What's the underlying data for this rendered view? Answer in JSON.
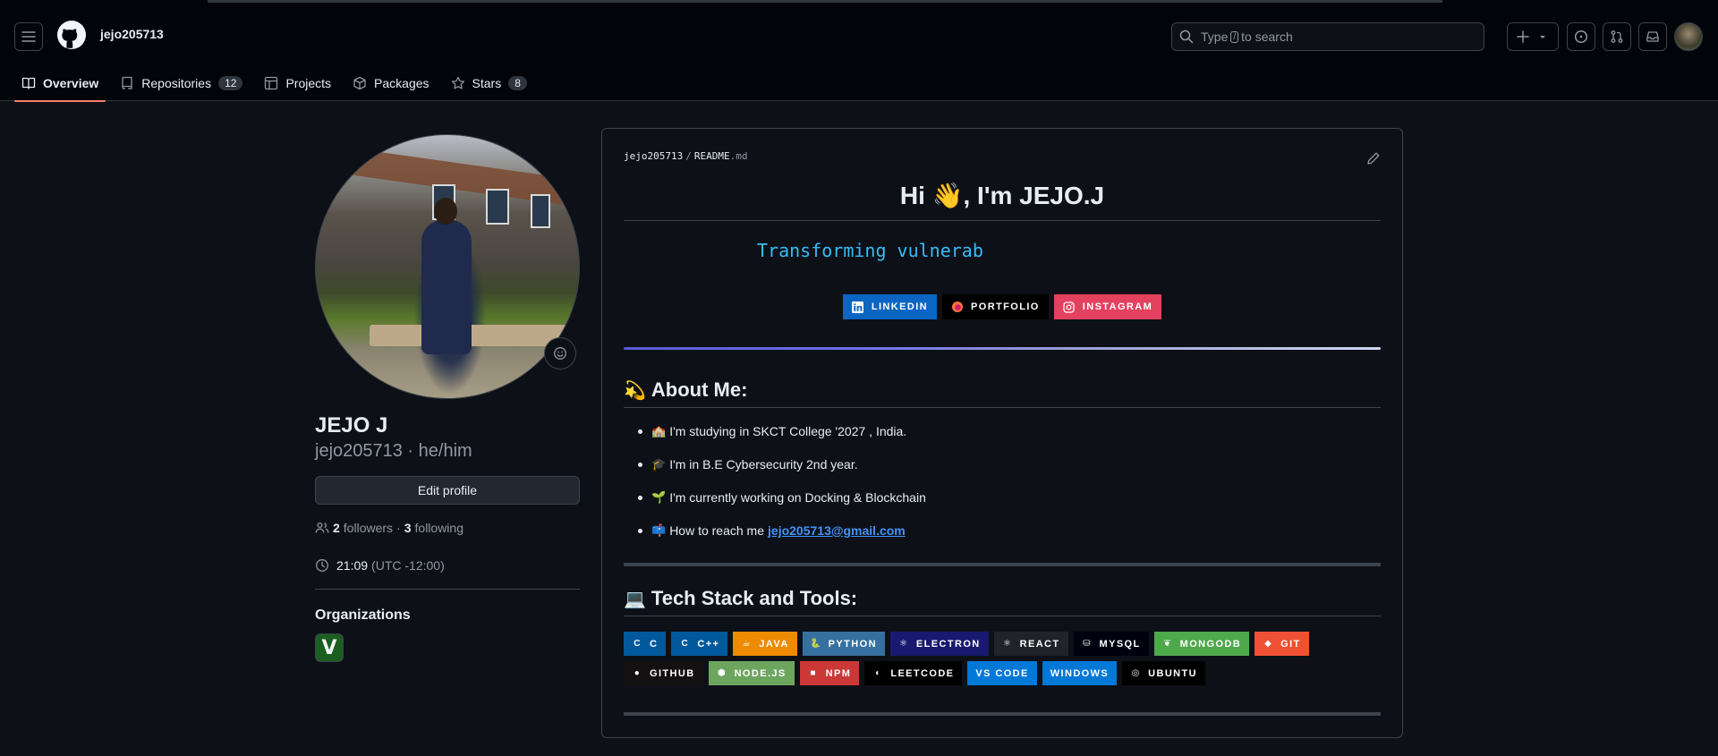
{
  "header": {
    "username": "jejo205713",
    "search_prefix": "Type",
    "search_key": "/",
    "search_suffix": "to search"
  },
  "tabs": [
    {
      "label": "Overview",
      "count": null
    },
    {
      "label": "Repositories",
      "count": "12"
    },
    {
      "label": "Projects",
      "count": null
    },
    {
      "label": "Packages",
      "count": null
    },
    {
      "label": "Stars",
      "count": "8"
    }
  ],
  "profile": {
    "full_name": "JEJO J",
    "handle": "jejo205713 · he/him",
    "edit_label": "Edit profile",
    "followers_count": "2",
    "followers_label": "followers",
    "dot": "·",
    "following_count": "3",
    "following_label": "following",
    "time": "21:09",
    "timezone": "(UTC -12:00)",
    "orgs_heading": "Organizations",
    "org_letter": "V"
  },
  "readme": {
    "owner": "jejo205713",
    "slash": "/",
    "file": "README",
    "ext": ".md",
    "title": "Hi 👋, I'm JEJO.J",
    "typing": "Transforming vulnerab",
    "socials": [
      {
        "label": "LINKEDIN",
        "color": "#0a66c2"
      },
      {
        "label": "PORTFOLIO",
        "color": "#000000"
      },
      {
        "label": "INSTAGRAM",
        "color": "#e4405f"
      }
    ],
    "about_emoji": "💫",
    "about_heading": "About Me:",
    "about_items": [
      {
        "emoji": "🏫",
        "text": "I'm studying in SKCT College '2027 , India.",
        "link": ""
      },
      {
        "emoji": "🎓",
        "text": "I'm in B.E Cybersecurity 2nd year.",
        "link": ""
      },
      {
        "emoji": "🌱",
        "text": "I'm currently working on Docking & Blockchain",
        "link": ""
      },
      {
        "emoji": "📫",
        "text": "How to reach me",
        "link": "jejo205713@gmail.com"
      }
    ],
    "tech_emoji": "💻",
    "tech_heading": "Tech Stack and Tools:",
    "tech": [
      {
        "label": "C",
        "color": "#00599c",
        "icon": "C"
      },
      {
        "label": "C++",
        "color": "#00599c",
        "icon": "C"
      },
      {
        "label": "JAVA",
        "color": "#ed8b00",
        "icon": "☕"
      },
      {
        "label": "PYTHON",
        "color": "#3670a0",
        "icon": "🐍"
      },
      {
        "label": "ELECTRON",
        "color": "#191970",
        "icon": "⚛"
      },
      {
        "label": "REACT",
        "color": "#20232a",
        "icon": "⚛"
      },
      {
        "label": "MYSQL",
        "color": "#00000f",
        "icon": "⛁"
      },
      {
        "label": "MONGODB",
        "color": "#4ea94b",
        "icon": "❦"
      },
      {
        "label": "GIT",
        "color": "#f05033",
        "icon": "◆"
      },
      {
        "label": "GITHUB",
        "color": "#121011",
        "icon": "●"
      },
      {
        "label": "NODE.JS",
        "color": "#6da55f",
        "icon": "⬢"
      },
      {
        "label": "NPM",
        "color": "#cb3837",
        "icon": "■"
      },
      {
        "label": "LEETCODE",
        "color": "#000000",
        "icon": "◐"
      },
      {
        "label": "VS CODE",
        "color": "#0078d7",
        "icon": ""
      },
      {
        "label": "WINDOWS",
        "color": "#0078d6",
        "icon": ""
      },
      {
        "label": "UBUNTU",
        "color": "#000000",
        "icon": "◎"
      }
    ]
  }
}
